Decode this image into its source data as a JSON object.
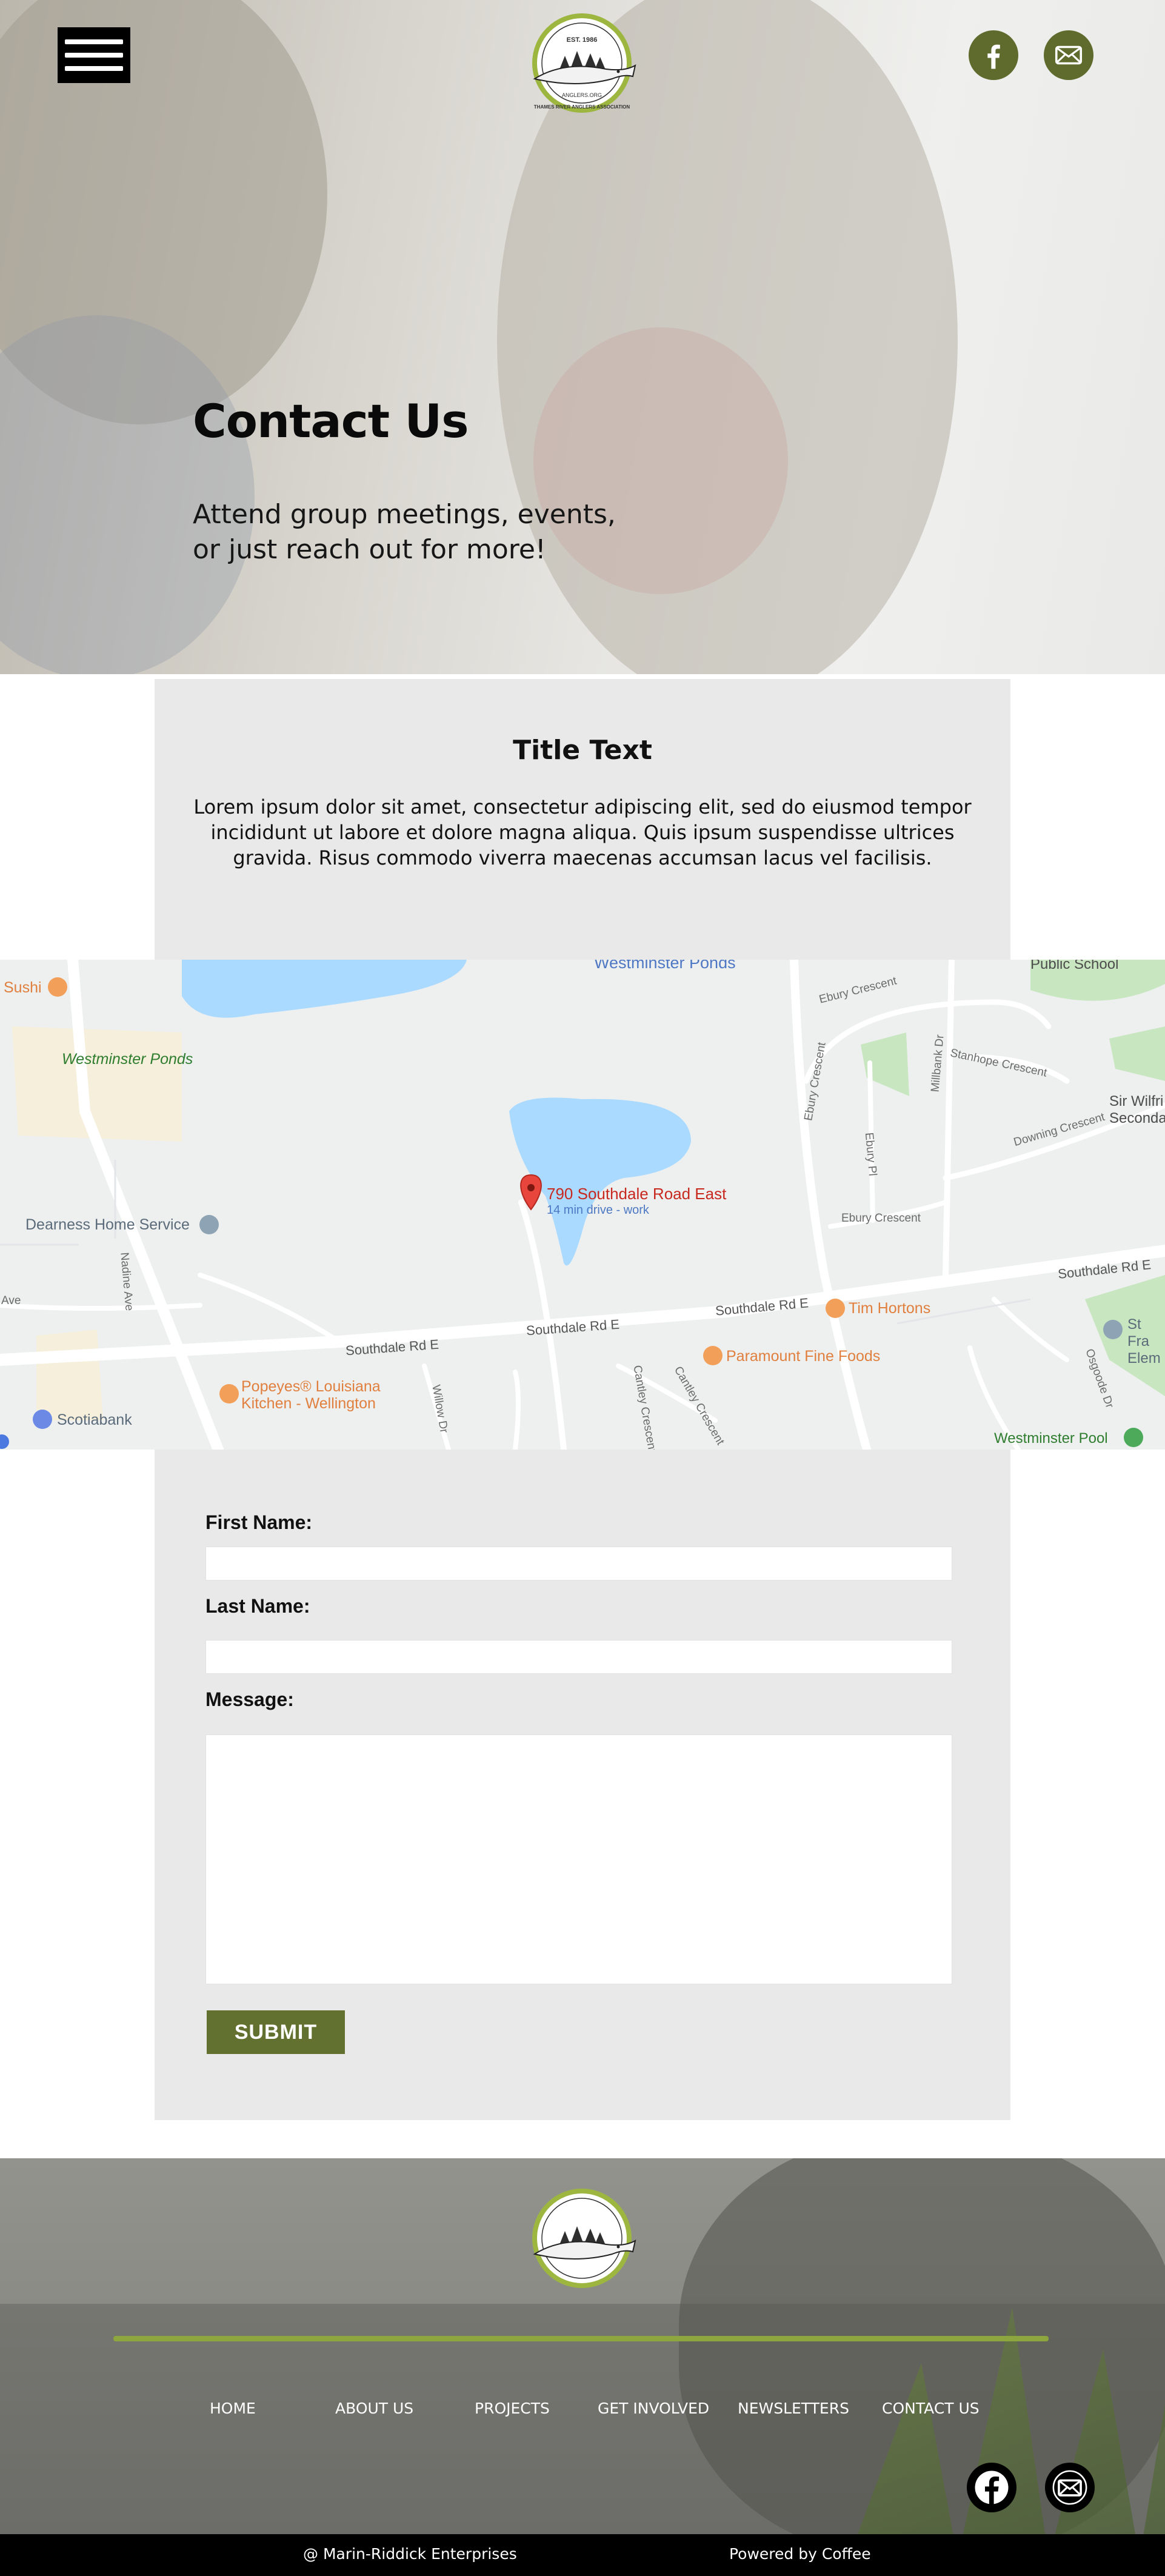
{
  "header": {
    "menu_icon": "hamburger-menu-icon",
    "logo": {
      "est": "EST. 1986",
      "site": "ANGLERS.ORG",
      "name": "THAMES RIVER ANGLERS ASSOCIATION"
    },
    "social": [
      {
        "icon": "facebook-icon"
      },
      {
        "icon": "mail-icon"
      }
    ]
  },
  "hero": {
    "title": "Contact Us",
    "subtitle": "Attend group meetings, events, or just reach out for more!"
  },
  "intro": {
    "title": "Title Text",
    "body": "Lorem ipsum dolor sit amet, consectetur adipiscing elit, sed do eiusmod tempor incididunt ut labore et dolore magna aliqua. Quis ipsum suspendisse ultrices gravida. Risus commodo viverra maecenas accumsan lacus vel facilisis."
  },
  "map": {
    "pin_address": "790 Southdale Road East",
    "pin_detail": "14 min drive - work",
    "labels": {
      "westminster_ponds_top": "Westminster Ponds",
      "westminster_ponds_left": "Westminster Ponds",
      "public_school": "Public School",
      "sushi": "Sushi",
      "ebury_crescent_1": "Ebury Crescent",
      "ebury_crescent_2": "Ebury Crescent",
      "ebury_crescent_3": "Ebury Crescent",
      "stanhope": "Stanhope Crescent",
      "millbank": "Millbank Dr",
      "sir_wilfrid": "Sir Wilfri Seconda",
      "downing": "Downing Crescent",
      "ebury_pl": "Ebury Pl",
      "dearness": "Dearness Home Service",
      "nadine": "Nadine Ave",
      "ave": "Ave",
      "southdale_1": "Southdale Rd E",
      "southdale_2": "Southdale Rd E",
      "southdale_3": "Southdale Rd E",
      "southdale_4": "Southdale Rd E",
      "tim_hortons": "Tim Hortons",
      "paramount": "Paramount Fine Foods",
      "popeyes": "Popeyes® Louisiana Kitchen - Wellington",
      "scotiabank": "Scotiabank",
      "willow": "Willow Dr",
      "cantley_1": "Cantley Crescent",
      "cantley_2": "Cantley Crescent",
      "st_fr": "St Fra Elem",
      "westminster_pool": "Westminster Pool",
      "osgoode": "Osgoode Dr"
    }
  },
  "form": {
    "first_name_label": "First Name:",
    "last_name_label": "Last Name:",
    "message_label": "Message:",
    "submit_label": "SUBMIT"
  },
  "footer": {
    "nav": [
      "HOME",
      "ABOUT US",
      "PROJECTS",
      "GET INVOLVED",
      "NEWSLETTERS",
      "CONTACT US"
    ],
    "copyright": "@ Marin-Riddick Enterprises",
    "powered": "Powered by Coffee"
  },
  "colors": {
    "accent_green": "#62712f",
    "line_green": "#8ea63f",
    "social_green": "#5e6b2c"
  }
}
